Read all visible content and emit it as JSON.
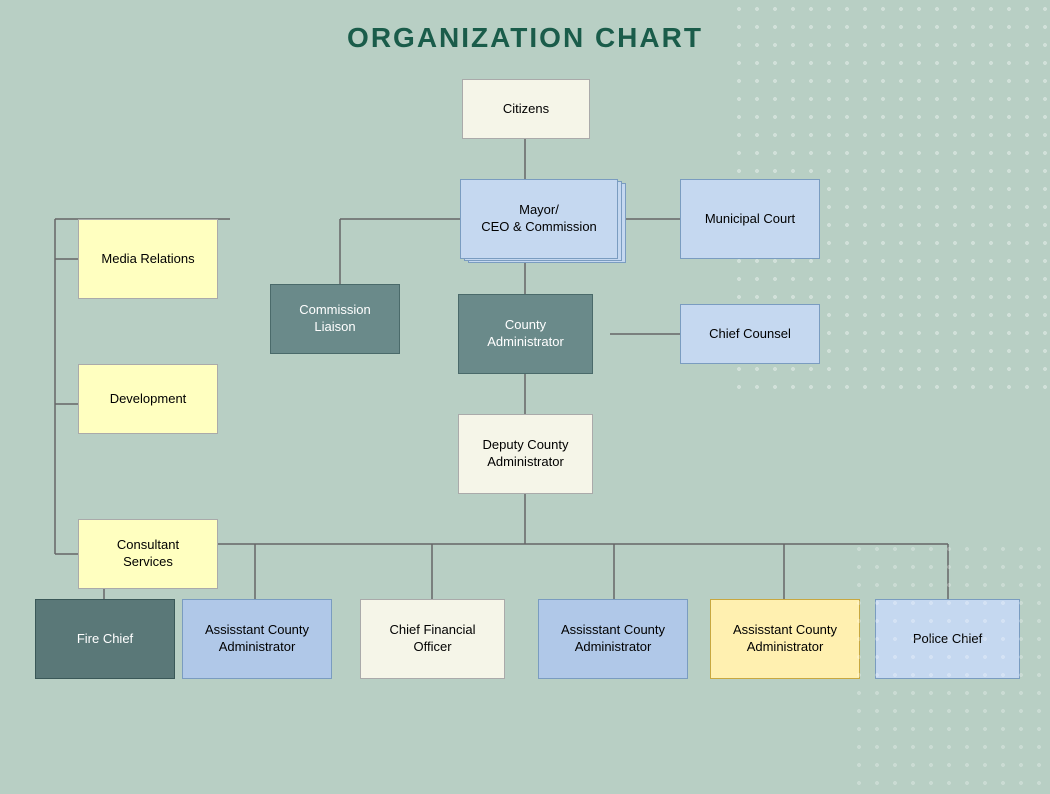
{
  "title": "ORGANIZATION CHART",
  "nodes": {
    "citizens": {
      "label": "Citizens"
    },
    "mayor": {
      "label": "Mayor/\nCEO & Commission"
    },
    "municipal_court": {
      "label": "Municipal Court"
    },
    "commission_liaison": {
      "label": "Commission\nLiaison"
    },
    "county_admin": {
      "label": "County\nAdministrator"
    },
    "chief_counsel": {
      "label": "Chief Counsel"
    },
    "media_relations": {
      "label": "Media Relations"
    },
    "development": {
      "label": "Development"
    },
    "consultant_services": {
      "label": "Consultant\nServices"
    },
    "deputy_county_admin": {
      "label": "Deputy County\nAdministrator"
    },
    "fire_chief": {
      "label": "Fire Chief"
    },
    "asst_county_admin_1": {
      "label": "Assisstant County\nAdministrator"
    },
    "cfo": {
      "label": "Chief Financial\nOfficer"
    },
    "asst_county_admin_2": {
      "label": "Assisstant County\nAdministrator"
    },
    "asst_county_admin_3": {
      "label": "Assisstant County\nAdministrator"
    },
    "police_chief": {
      "label": "Police Chief"
    }
  }
}
